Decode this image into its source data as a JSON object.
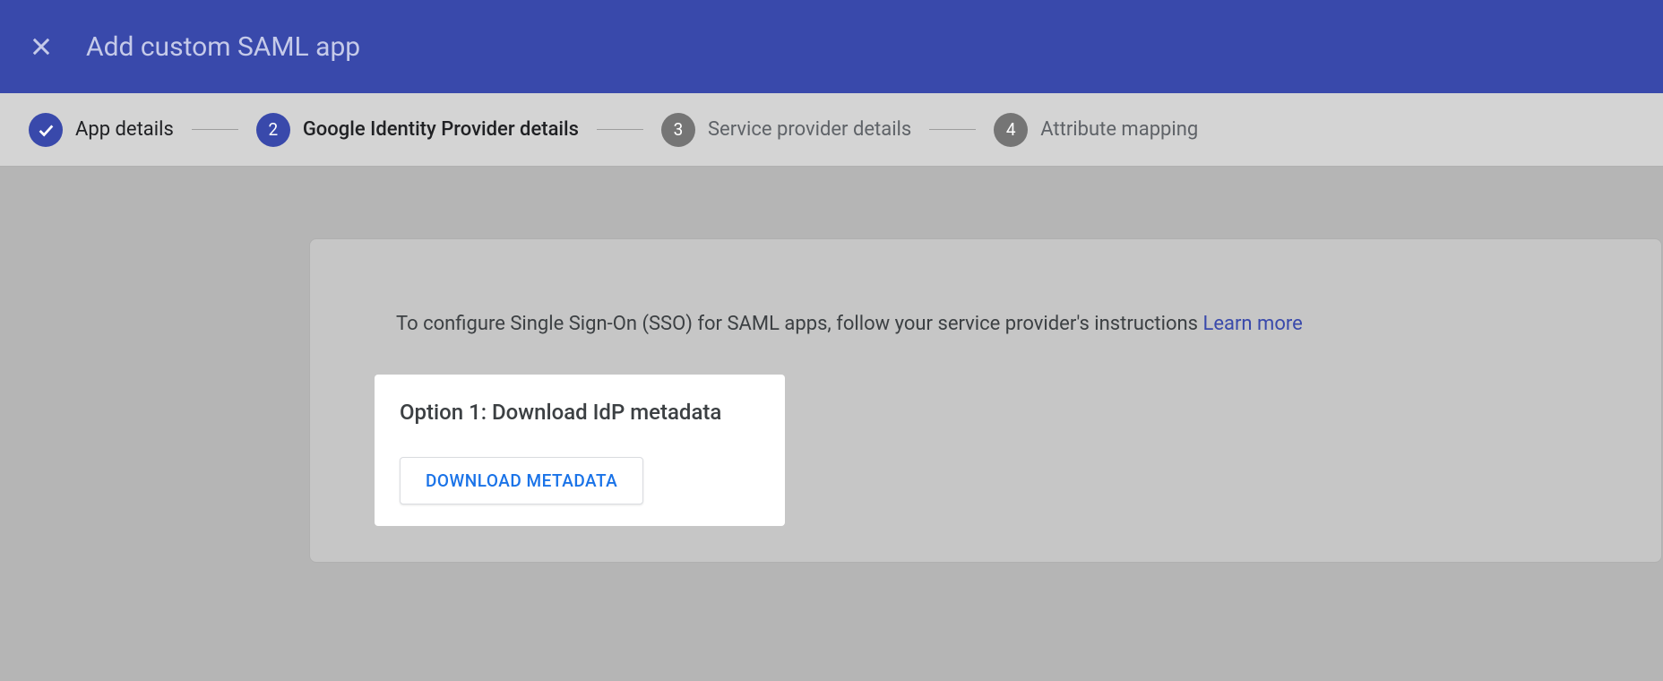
{
  "header": {
    "title": "Add custom SAML app"
  },
  "stepper": {
    "steps": [
      {
        "label": "App details",
        "state": "done"
      },
      {
        "number": "2",
        "label": "Google Identity Provider details",
        "state": "current"
      },
      {
        "number": "3",
        "label": "Service provider details",
        "state": "future"
      },
      {
        "number": "4",
        "label": "Attribute mapping",
        "state": "future"
      }
    ]
  },
  "content": {
    "intro": "To configure Single Sign-On (SSO) for SAML apps, follow your service provider's instructions ",
    "learn_more": "Learn more",
    "option1_title": "Option 1: Download IdP metadata",
    "download_label": "DOWNLOAD METADATA"
  }
}
